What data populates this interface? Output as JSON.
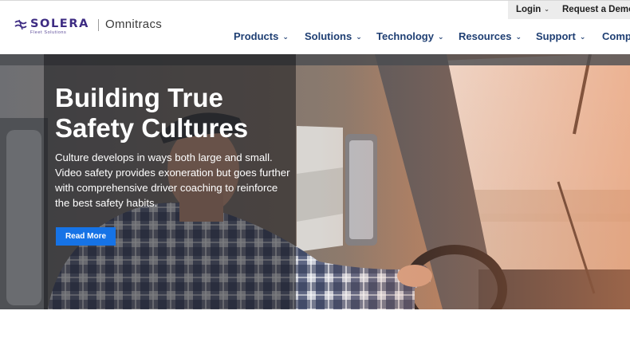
{
  "utility_bar": {
    "login_label": "Login",
    "demo_label": "Request a Demo"
  },
  "logo": {
    "wordmark": "SOLERA",
    "tagline": "Fleet Solutions",
    "brand": "Omnitracs",
    "mark_icon": "solera-wave-icon"
  },
  "nav": {
    "items": [
      {
        "label": "Products"
      },
      {
        "label": "Solutions"
      },
      {
        "label": "Technology"
      },
      {
        "label": "Resources"
      },
      {
        "label": "Support"
      },
      {
        "label": "Comp"
      }
    ]
  },
  "hero": {
    "title_line1": "Building True",
    "title_line2": "Safety Cultures",
    "body": "Culture develops in ways both large and small. Video safety provides exoneration but goes further with comprehensive driver coaching to reinforce the best safety habits.",
    "cta_label": "Read More"
  },
  "colors": {
    "brand_purple": "#3d2b82",
    "nav_text": "#1f3f73",
    "cta_blue": "#1673e6",
    "utility_bg": "#ececec"
  }
}
